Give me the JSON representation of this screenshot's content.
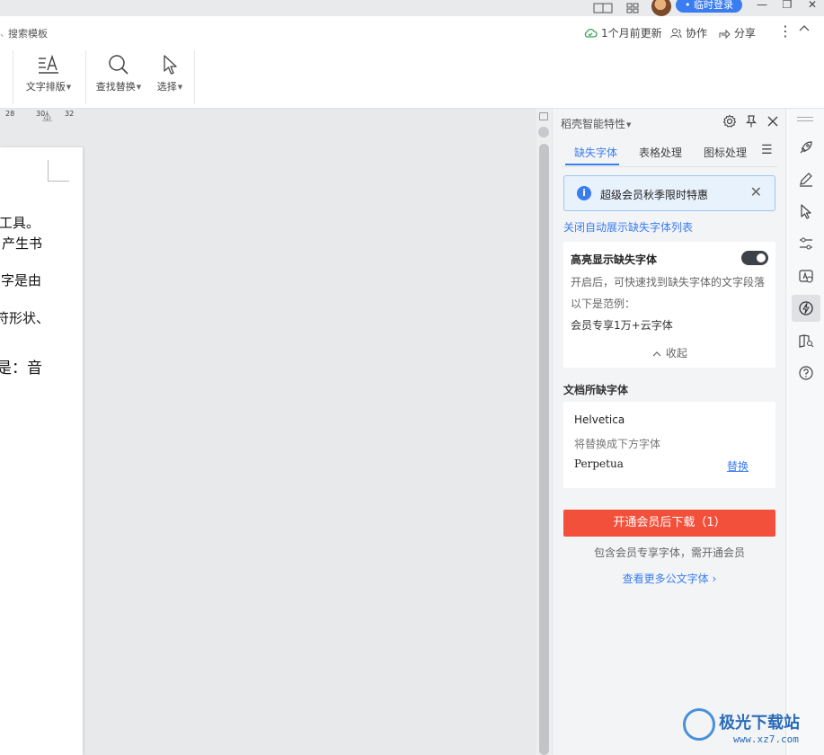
{
  "titlebar": {
    "login_label": "• 临时登录",
    "minimize": "—",
    "restore": "❐",
    "close": "✕"
  },
  "ribbon": {
    "search_template": "搜索模板",
    "updated": "1个月前更新",
    "collab": "协作",
    "share": "分享",
    "tools": [
      {
        "label": "文字排版",
        "icon": "text-layout-icon"
      },
      {
        "label": "查找替换",
        "icon": "magnifier-icon"
      },
      {
        "label": "选择",
        "icon": "cursor-icon"
      }
    ]
  },
  "ruler": {
    "ticks": [
      "28",
      "30",
      "32"
    ]
  },
  "document": {
    "lines": [
      "工具。",
      "产生书",
      "字是由",
      "符形状、",
      "是：音"
    ]
  },
  "panel": {
    "header": "稻壳智能特性",
    "tabs": [
      "缺失字体",
      "表格处理",
      "图标处理"
    ],
    "active_tab": 0,
    "notice": "超级会员秋季限时特惠",
    "close_list_link": "关闭自动展示缺失字体列表",
    "highlight": {
      "title": "高亮显示缺失字体",
      "desc": "开启后，可快速找到缺失字体的文字段落",
      "example_label": "以下是范例：",
      "example_text": "会员专享1万+云字体",
      "collapse": "收起",
      "toggle_on": true
    },
    "missing_title": "文档所缺字体",
    "missing": {
      "font": "Helvetica",
      "replace_note": "将替换成下方字体",
      "replacement": "Perpetua",
      "replace_action": "替换"
    },
    "download_button": "开通会员后下载（1）",
    "vip_note": "包含会员专享字体，需开通会员",
    "more_link": "查看更多公文字体"
  },
  "watermark": {
    "text": "极光下载站",
    "url": "www.xz7.com"
  },
  "colors": {
    "accent": "#3a7df0",
    "download": "#f2503a",
    "panel_bg": "#f3f4f6"
  }
}
